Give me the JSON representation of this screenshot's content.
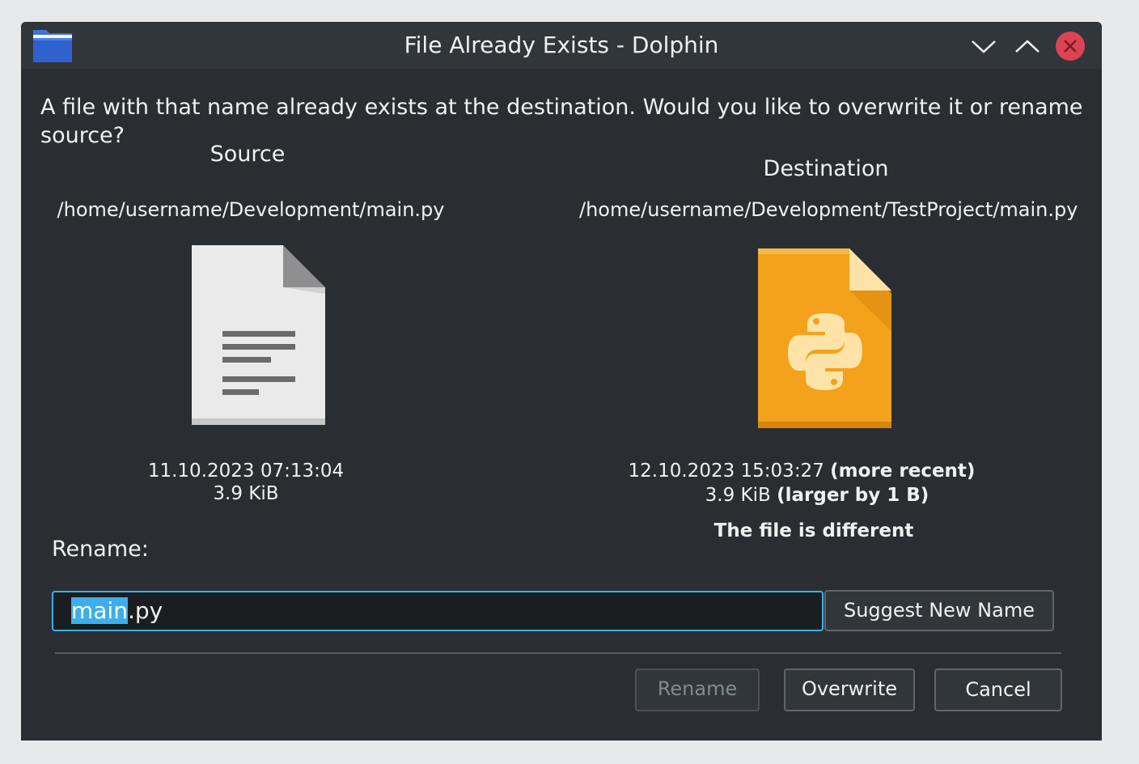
{
  "window": {
    "title": "File Already Exists - Dolphin",
    "app_icon": "folder-icon",
    "controls": [
      "minimize-icon",
      "maximize-icon",
      "close-icon"
    ]
  },
  "message": "A file with that name already exists at the destination. Would you like to overwrite it or rename source?",
  "source": {
    "heading": "Source",
    "path": "/home/username/Development/main.py",
    "icon": "text-document-icon",
    "date": "11.10.2023 07:13:04",
    "size": "3.9 KiB"
  },
  "destination": {
    "heading": "Destination",
    "path": "/home/username/Development/TestProject/main.py",
    "icon": "python-file-icon",
    "date": "12.10.2023 15:03:27",
    "date_note": "(more recent)",
    "size": "3.9 KiB",
    "size_note": "(larger by 1 B)",
    "difference": "The file is different"
  },
  "rename": {
    "label": "Rename:",
    "value_selected": "main",
    "value_rest": ".py",
    "suggest_button": "Suggest New Name"
  },
  "buttons": {
    "rename": "Rename",
    "overwrite": "Overwrite",
    "cancel": "Cancel"
  },
  "colors": {
    "accent": "#3daee9",
    "close": "#da4453",
    "python_file": "#f4a11b"
  }
}
